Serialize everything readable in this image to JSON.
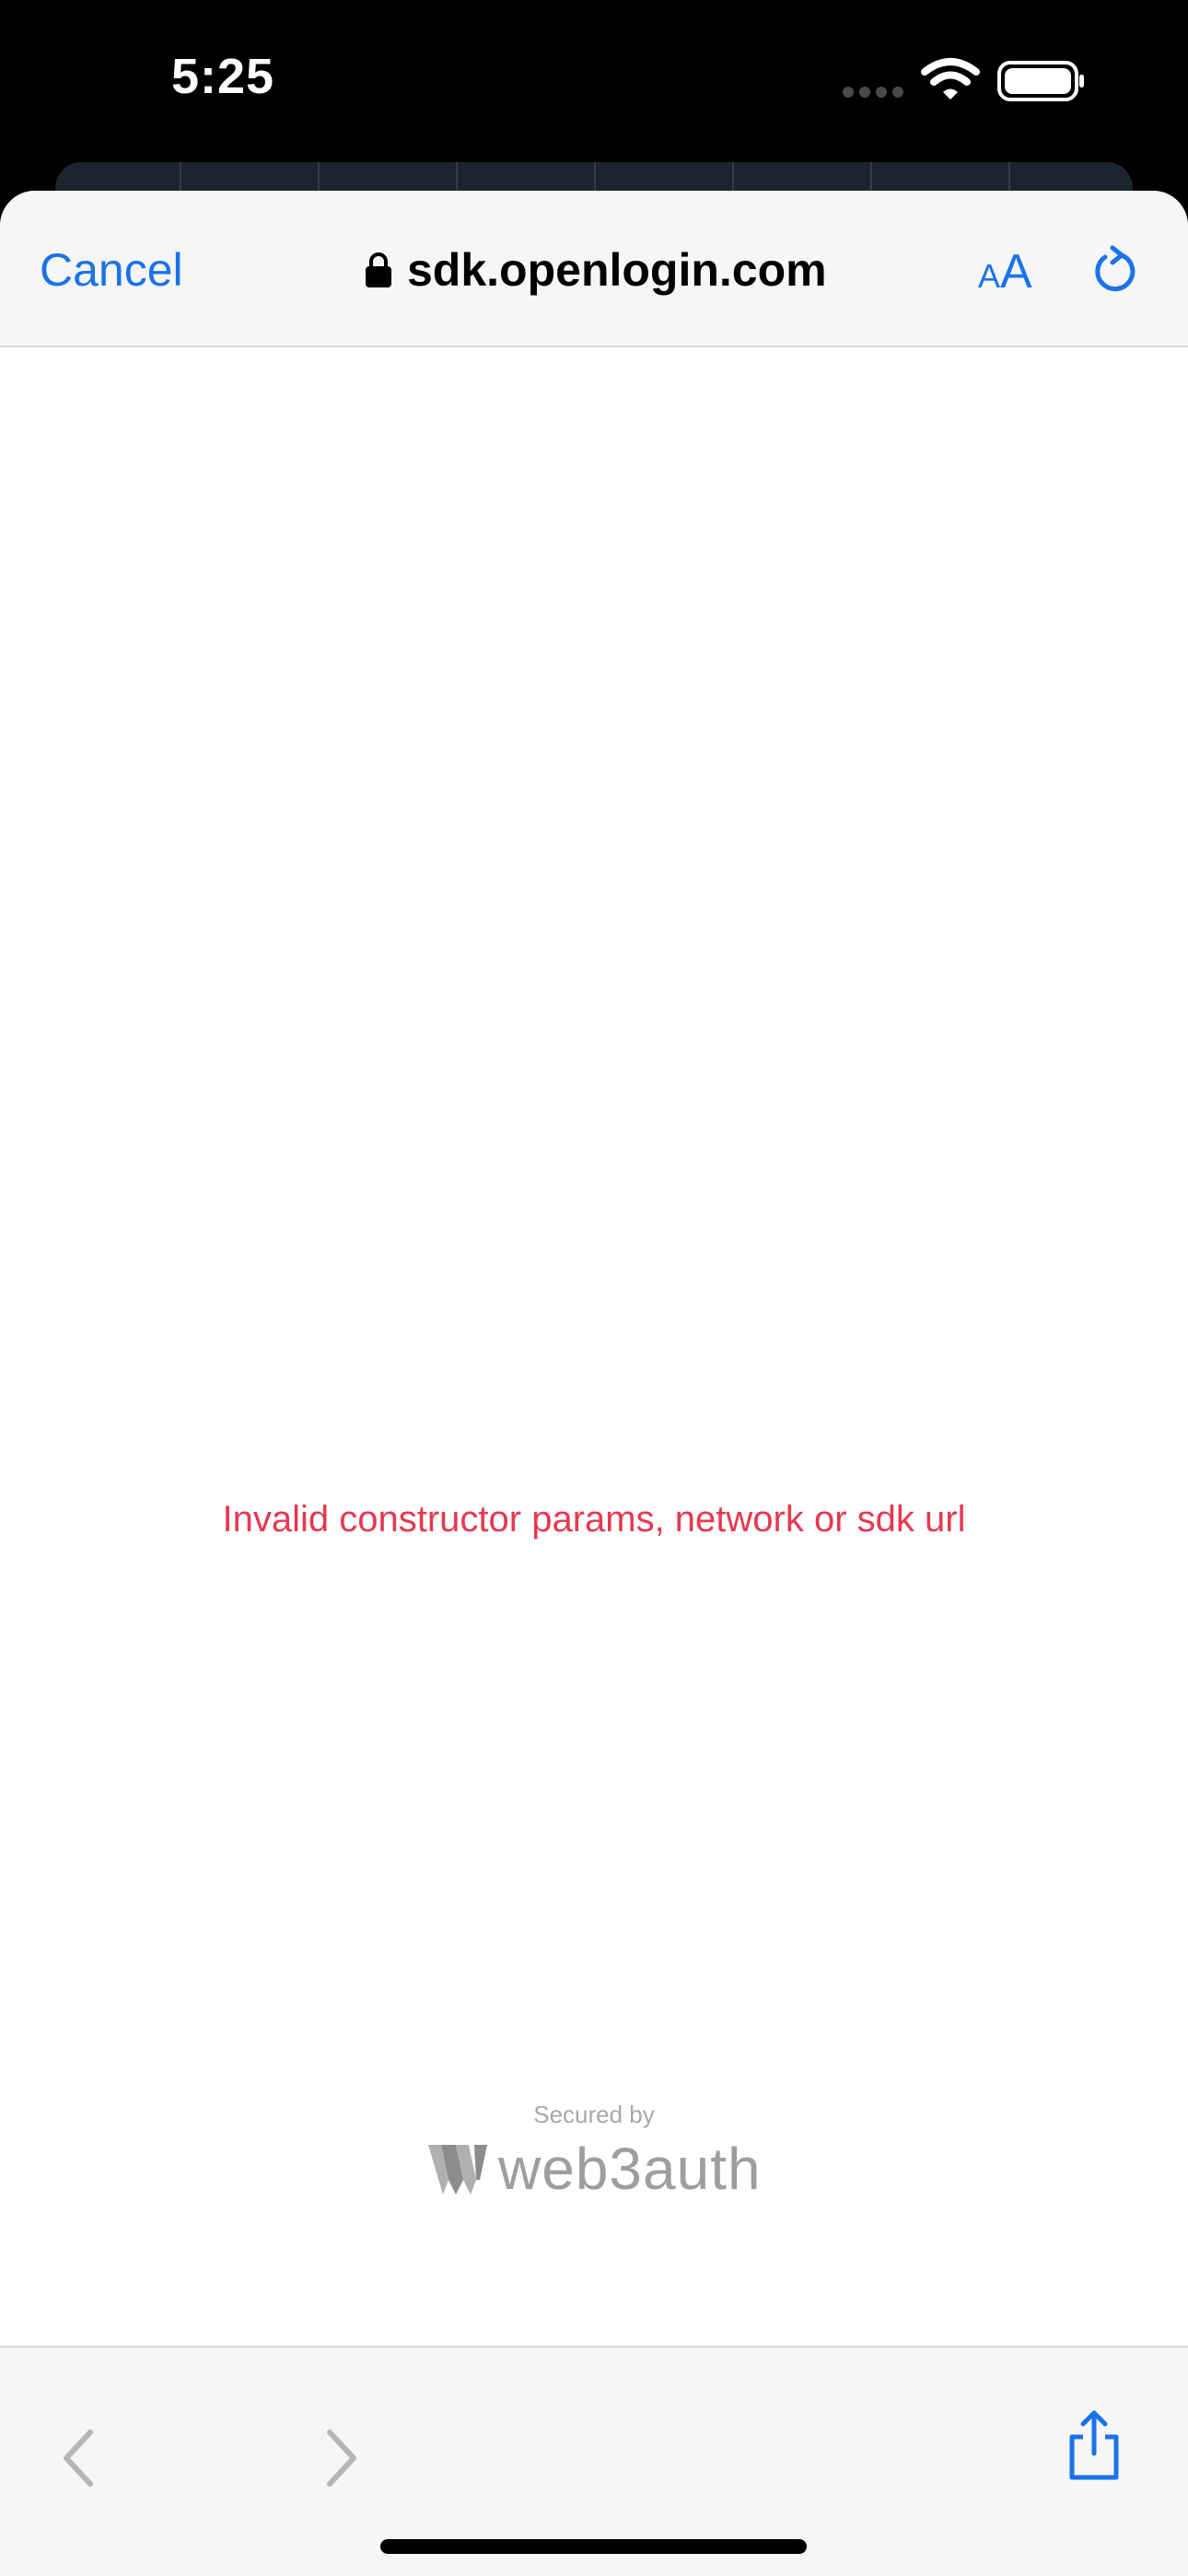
{
  "status_bar": {
    "time": "5:25",
    "icons": [
      "cellular-signal-icon",
      "wifi-icon",
      "battery-icon"
    ]
  },
  "browser": {
    "cancel_label": "Cancel",
    "url": "sdk.openlogin.com",
    "text_size_label_small": "A",
    "text_size_label_large": "A",
    "icons": [
      "lock-icon",
      "reload-icon",
      "back-arrow-icon",
      "forward-arrow-icon",
      "share-icon"
    ]
  },
  "page": {
    "error_message": "Invalid constructor params, network or sdk url",
    "secured_by": "Secured by",
    "brand_name": "web3auth"
  },
  "colors": {
    "accent": "#1a73e8",
    "error": "#e53950",
    "muted": "#9e9e9e"
  }
}
